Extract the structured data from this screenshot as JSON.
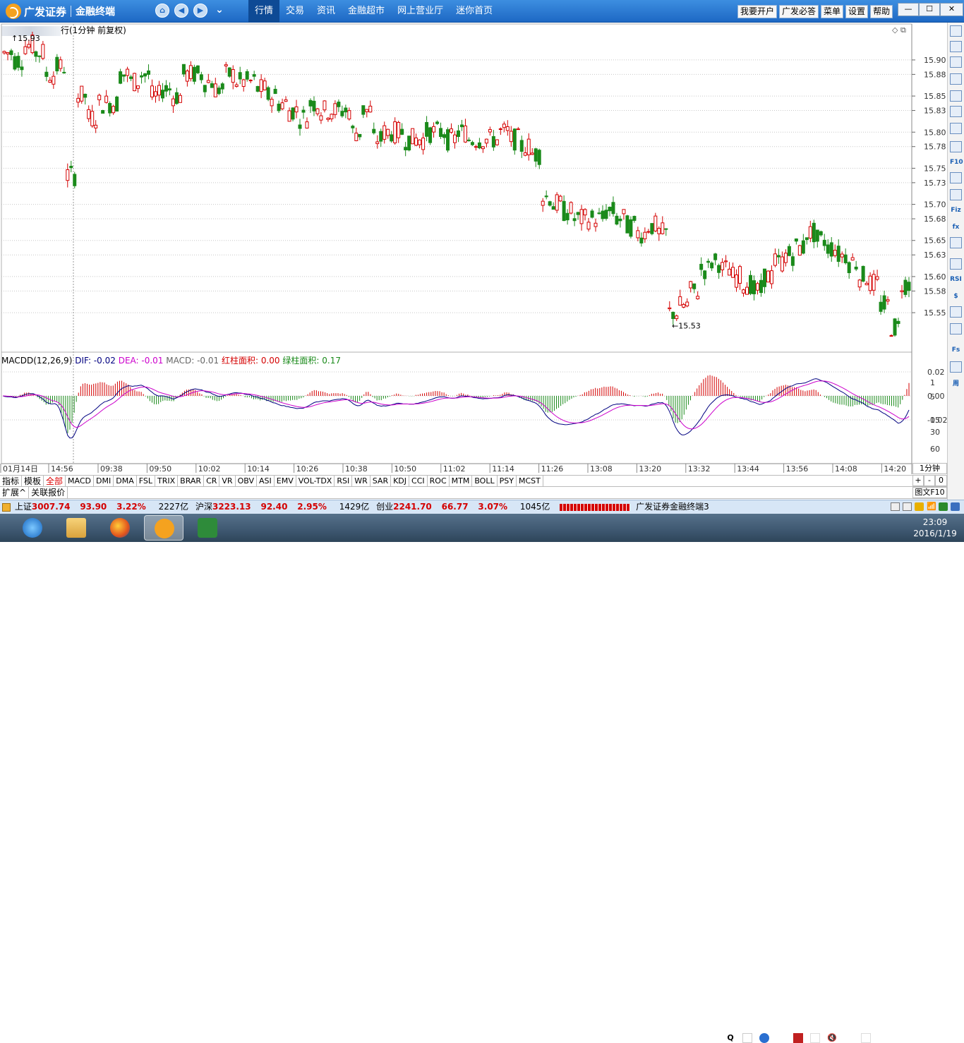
{
  "app": {
    "brand": "广发证券",
    "product": "金融终端"
  },
  "menus": [
    {
      "label": "行情",
      "active": true
    },
    {
      "label": "交易",
      "active": false
    },
    {
      "label": "资讯",
      "active": false
    },
    {
      "label": "金融超市",
      "active": false
    },
    {
      "label": "网上营业厅",
      "active": false
    },
    {
      "label": "迷你首页",
      "active": false
    }
  ],
  "topright": [
    "我要开户",
    "广发必答",
    "菜单",
    "设置",
    "帮助"
  ],
  "chart": {
    "title_suffix": "行(1分钟 前复权)",
    "high_label": "15.93",
    "low_label": "15.53",
    "macd_legend": {
      "name": "MACDD(12,26,9)",
      "dif": "DIF: -0.02",
      "dea": "DEA: -0.01",
      "macd": "MACD: -0.01",
      "red_area": "红柱面积: 0.00",
      "green_area": "绿柱面积: 0.17"
    },
    "colors": {
      "up": "#d40000",
      "down": "#1a8a1a",
      "dif": "#000080",
      "dea": "#cc00cc",
      "grid": "#c8c8c8"
    }
  },
  "chart_data": {
    "type": "candlestick",
    "price_ticks": [
      "15.90",
      "15.88",
      "15.85",
      "15.83",
      "15.80",
      "15.78",
      "15.75",
      "15.73",
      "15.70",
      "15.68",
      "15.65",
      "15.63",
      "15.60",
      "15.58",
      "15.55"
    ],
    "macd_ticks": [
      "0.02",
      "0.00",
      "-0.02"
    ],
    "volume_ticks": [
      "1",
      "5",
      "15",
      "30",
      "60"
    ],
    "time_labels": [
      "01月14日",
      "14:56",
      "09:38",
      "09:50",
      "10:02",
      "10:14",
      "10:26",
      "10:38",
      "10:50",
      "11:02",
      "11:14",
      "11:26",
      "13:08",
      "13:20",
      "13:32",
      "13:44",
      "13:56",
      "14:08",
      "14:20"
    ],
    "ylim": [
      15.51,
      15.94
    ],
    "close_path": [
      15.91,
      15.9,
      15.92,
      15.91,
      15.88,
      15.89,
      15.74,
      15.85,
      15.82,
      15.84,
      15.84,
      15.88,
      15.87,
      15.88,
      15.85,
      15.86,
      15.85,
      15.88,
      15.88,
      15.87,
      15.86,
      15.88,
      15.87,
      15.87,
      15.86,
      15.85,
      15.84,
      15.83,
      15.82,
      15.84,
      15.83,
      15.83,
      15.83,
      15.8,
      15.83,
      15.79,
      15.8,
      15.8,
      15.79,
      15.79,
      15.8,
      15.8,
      15.79,
      15.8,
      15.79,
      15.79,
      15.79,
      15.8,
      15.79,
      15.78,
      15.77,
      15.71,
      15.7,
      15.69,
      15.68,
      15.68,
      15.68,
      15.69,
      15.68,
      15.67,
      15.66,
      15.67,
      15.66,
      15.55,
      15.56,
      15.58,
      15.61,
      15.62,
      15.61,
      15.6,
      15.59,
      15.58,
      15.6,
      15.62,
      15.63,
      15.64,
      15.66,
      15.65,
      15.64,
      15.63,
      15.62,
      15.6,
      15.59,
      15.56,
      15.53,
      15.59
    ]
  },
  "indicator_tabs": [
    "指标",
    "模板",
    "全部",
    "MACD",
    "DMI",
    "DMA",
    "FSL",
    "TRIX",
    "BRAR",
    "CR",
    "VR",
    "OBV",
    "ASI",
    "EMV",
    "VOL-TDX",
    "RSI",
    "WR",
    "SAR",
    "KDJ",
    "CCI",
    "ROC",
    "MTM",
    "BOLL",
    "PSY",
    "MCST"
  ],
  "bottom_tabs": [
    "扩展^",
    "关联报价"
  ],
  "right_ctrl": {
    "period": "1分钟",
    "plus": "+",
    "minus": "-",
    "zero": "0",
    "figure": "图文F10"
  },
  "status": {
    "sh_label": "上证",
    "sh_val": "3007.74",
    "sh_chg": "93.90",
    "sh_pct": "3.22%",
    "sh_amt": "2227亿",
    "hs_label": "沪深",
    "hs_val": "3223.13",
    "hs_chg": "92.40",
    "hs_pct": "2.95%",
    "hs_amt": "1429亿",
    "cy_label": "创业",
    "cy_val": "2241.70",
    "cy_chg": "66.77",
    "cy_pct": "3.07%",
    "cy_amt": "1045亿",
    "app_name": "广发证券金融终端3"
  },
  "rightbar_icons": [
    "up-icon",
    "up-arrow-icon",
    "down-arrow-icon",
    "list-icon",
    "grid-icon",
    "line-chart-icon",
    "kline-icon",
    "report-icon",
    "f10-icon",
    "info-icon",
    "news-icon",
    "fiz-icon",
    "fx-icon",
    "circle-icon",
    "trend-icon",
    "rsi-icon",
    "dollar-icon",
    "move-icon",
    "pen-icon",
    "fs-icon",
    "refresh-icon",
    "zhou-icon"
  ],
  "rightbar_labels": [
    "",
    "",
    "",
    "",
    "",
    "",
    "",
    "",
    "F10",
    "",
    "",
    "Fiz",
    "fx",
    "",
    "",
    "RSI",
    "$",
    "",
    "",
    "Fs",
    "",
    "周"
  ],
  "clock": {
    "time": "23:09",
    "date": "2016/1/19"
  }
}
